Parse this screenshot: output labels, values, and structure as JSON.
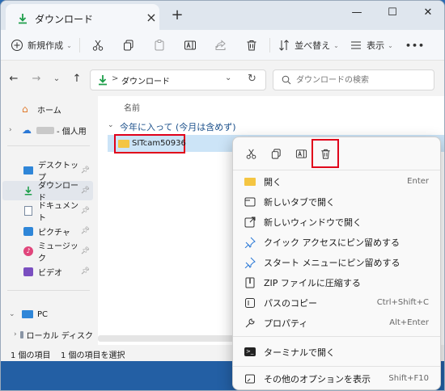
{
  "tab": {
    "title": "ダウンロード",
    "close": "×",
    "new": "+"
  },
  "window_controls": {
    "minimize": "—",
    "maximize": "☐",
    "close": "✕"
  },
  "toolbar": {
    "new_label": "新規作成",
    "sort_label": "並べ替え",
    "view_label": "表示",
    "more": "•••"
  },
  "address": {
    "path": "ダウンロード",
    "separator": ">"
  },
  "search": {
    "placeholder": "ダウンロードの検索"
  },
  "sidebar": {
    "items": [
      {
        "label": "ホーム"
      },
      {
        "label": "- 個人用"
      },
      {
        "label": "デスクトップ"
      },
      {
        "label": "ダウンロード"
      },
      {
        "label": "ドキュメント"
      },
      {
        "label": "ピクチャ"
      },
      {
        "label": "ミュージック"
      },
      {
        "label": "ビデオ"
      },
      {
        "label": "PC"
      },
      {
        "label": "ローカル ディスク"
      }
    ]
  },
  "content": {
    "column_header": "名前",
    "group_label": "今年に入って (今月は含めず)",
    "file_name": "SITcam50936"
  },
  "status": {
    "count": "1 個の項目",
    "selection": "1 個の項目を選択"
  },
  "context_menu": {
    "items": [
      {
        "label": "開く",
        "shortcut": "Enter"
      },
      {
        "label": "新しいタブで開く",
        "shortcut": ""
      },
      {
        "label": "新しいウィンドウで開く",
        "shortcut": ""
      },
      {
        "label": "クイック アクセスにピン留めする",
        "shortcut": ""
      },
      {
        "label": "スタート メニューにピン留めする",
        "shortcut": ""
      },
      {
        "label": "ZIP ファイルに圧縮する",
        "shortcut": ""
      },
      {
        "label": "パスのコピー",
        "shortcut": "Ctrl+Shift+C"
      },
      {
        "label": "プロパティ",
        "shortcut": "Alt+Enter"
      },
      {
        "label": "ターミナルで開く",
        "shortcut": ""
      },
      {
        "label": "その他のオプションを表示",
        "shortcut": "Shift+F10"
      }
    ]
  },
  "colors": {
    "accent": "#0067c0",
    "folder": "#f4c542",
    "highlight": "#e0001a",
    "taskbar": "#235fa4"
  }
}
